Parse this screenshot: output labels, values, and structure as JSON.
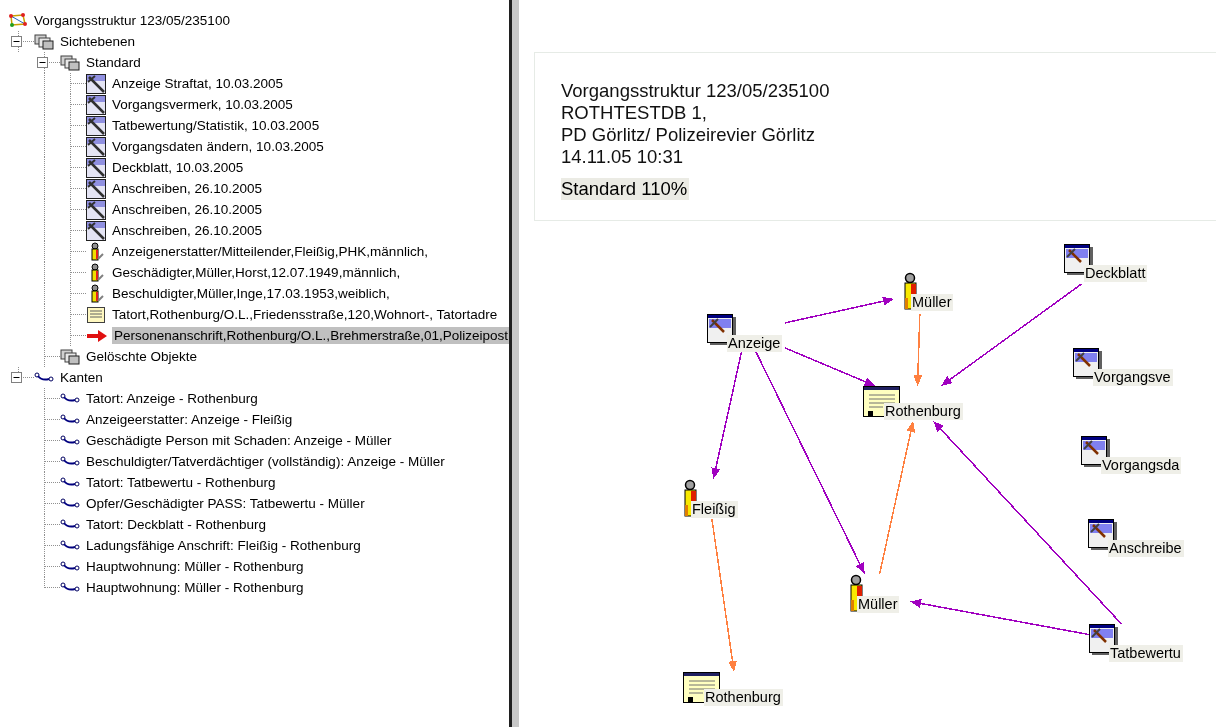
{
  "tree": {
    "label": "Vorgangsstruktur 123/05/235100",
    "kind": "root",
    "selected": false,
    "children": [
      {
        "label": "Sichtebenen",
        "kind": "folder",
        "expanded": true,
        "selected": false,
        "children": [
          {
            "label": "Standard",
            "kind": "folder",
            "expanded": true,
            "selected": false,
            "children": [
              {
                "label": "Anzeige Straftat, 10.03.2005",
                "kind": "document",
                "selected": false
              },
              {
                "label": "Vorgangsvermerk, 10.03.2005",
                "kind": "document",
                "selected": false
              },
              {
                "label": "Tatbewertung/Statistik, 10.03.2005",
                "kind": "document",
                "selected": false
              },
              {
                "label": "Vorgangsdaten ändern, 10.03.2005",
                "kind": "document",
                "selected": false
              },
              {
                "label": "Deckblatt, 10.03.2005",
                "kind": "document",
                "selected": false
              },
              {
                "label": "Anschreiben, 26.10.2005",
                "kind": "document",
                "selected": false
              },
              {
                "label": "Anschreiben, 26.10.2005",
                "kind": "document",
                "selected": false
              },
              {
                "label": "Anschreiben, 26.10.2005",
                "kind": "document",
                "selected": false
              },
              {
                "label": "Anzeigenerstatter/Mitteilender,Fleißig,PHK,männlich,",
                "kind": "person",
                "selected": false
              },
              {
                "label": "Geschädigter,Müller,Horst,12.07.1949,männlich,",
                "kind": "person",
                "selected": false
              },
              {
                "label": "Beschuldigter,Müller,Inge,17.03.1953,weiblich,",
                "kind": "person",
                "selected": false
              },
              {
                "label": "Tatort,Rothenburg/O.L.,Friedensstraße,120,Wohnort-, Tatortadre",
                "kind": "address",
                "selected": false
              },
              {
                "label": "Personenanschrift,Rothenburg/O.L.,Brehmerstraße,01,Polizeipost",
                "kind": "arrow",
                "selected": true
              }
            ]
          },
          {
            "label": "Gelöschte Objekte",
            "kind": "folder",
            "selected": false
          }
        ]
      },
      {
        "label": "Kanten",
        "kind": "edge",
        "expanded": true,
        "selected": false,
        "children": [
          {
            "label": "Tatort: Anzeige - Rothenburg",
            "kind": "edge",
            "selected": false
          },
          {
            "label": "Anzeigeerstatter: Anzeige - Fleißig",
            "kind": "edge",
            "selected": false
          },
          {
            "label": "Geschädigte Person mit Schaden: Anzeige - Müller",
            "kind": "edge",
            "selected": false
          },
          {
            "label": "Beschuldigter/Tatverdächtiger (vollständig): Anzeige - Müller",
            "kind": "edge",
            "selected": false
          },
          {
            "label": "Tatort: Tatbewertu - Rothenburg",
            "kind": "edge",
            "selected": false
          },
          {
            "label": "Opfer/Geschädigter PASS: Tatbewertu - Müller",
            "kind": "edge",
            "selected": false
          },
          {
            "label": "Tatort: Deckblatt - Rothenburg",
            "kind": "edge",
            "selected": false
          },
          {
            "label": "Ladungsfähige Anschrift: Fleißig - Rothenburg",
            "kind": "edge",
            "selected": false
          },
          {
            "label": "Hauptwohnung: Müller - Rothenburg",
            "kind": "edge",
            "selected": false
          },
          {
            "label": "Hauptwohnung: Müller - Rothenburg",
            "kind": "edge",
            "selected": false
          }
        ]
      }
    ]
  },
  "header": {
    "lines": [
      "Vorgangsstruktur 123/05/235100",
      "ROTHTESTDB 1,",
      "PD Görlitz/ Polizeirevier Görlitz",
      "14.11.05 10:31"
    ],
    "view": "Standard 110%"
  },
  "graph": {
    "nodes": [
      {
        "label": "Anzeige",
        "kind": "document"
      },
      {
        "label": "Müller",
        "kind": "person"
      },
      {
        "label": "Deckblatt",
        "kind": "document"
      },
      {
        "label": "Rothenburg",
        "kind": "address"
      },
      {
        "label": "Vorgangsve",
        "kind": "document"
      },
      {
        "label": "Vorgangsda",
        "kind": "document"
      },
      {
        "label": "Anschreibe",
        "kind": "document"
      },
      {
        "label": "Fleißig",
        "kind": "person"
      },
      {
        "label": "Müller",
        "kind": "person"
      },
      {
        "label": "Tatbewertu",
        "kind": "document"
      },
      {
        "label": "Rothenburg",
        "kind": "address"
      }
    ],
    "edges": [
      {
        "color": "#a000c0"
      },
      {
        "color": "#ff8040"
      },
      {
        "color": "#a000c0"
      },
      {
        "color": "#a000c0"
      },
      {
        "color": "#a000c0"
      },
      {
        "color": "#a000c0"
      },
      {
        "color": "#ff8040"
      },
      {
        "color": "#a000c0"
      },
      {
        "color": "#a000c0"
      },
      {
        "color": "#ff8040"
      }
    ]
  }
}
